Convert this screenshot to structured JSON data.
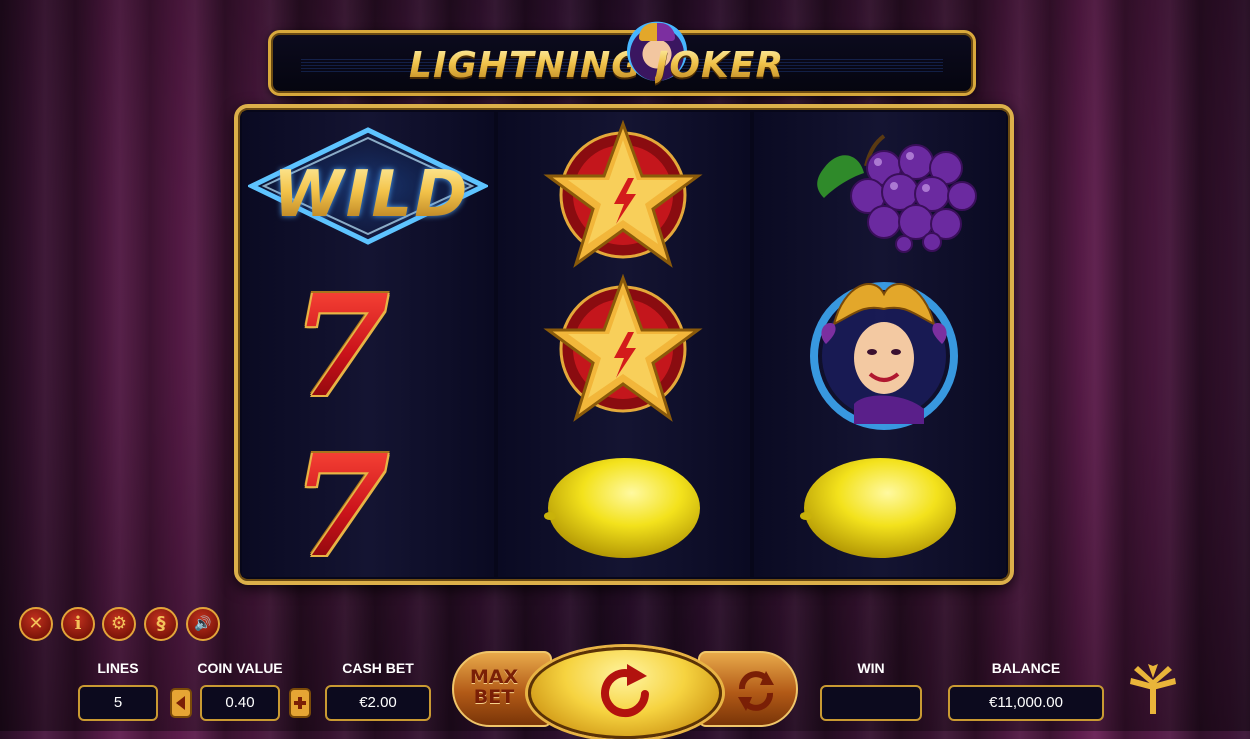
{
  "game": {
    "title_left": "LIGHTNING",
    "title_right": "JOKER"
  },
  "reels": [
    [
      "wild",
      "seven",
      "seven"
    ],
    [
      "star",
      "star",
      "lemon"
    ],
    [
      "grapes",
      "joker",
      "lemon"
    ]
  ],
  "symbols": {
    "wild_text": "WILD",
    "seven_text": "7"
  },
  "toolbar_icons": [
    {
      "name": "close-icon",
      "glyph": "✕"
    },
    {
      "name": "info-icon",
      "glyph": "i"
    },
    {
      "name": "settings-icon",
      "glyph": "⚙"
    },
    {
      "name": "paytable-icon",
      "glyph": "§"
    },
    {
      "name": "sound-icon",
      "glyph": "🔊"
    }
  ],
  "controls": {
    "lines_label": "LINES",
    "lines_value": "5",
    "coin_value_label": "COIN VALUE",
    "coin_value": "0.40",
    "cash_bet_label": "CASH BET",
    "cash_bet_value": "€2.00",
    "max_bet_label_1": "MAX",
    "max_bet_label_2": "BET",
    "win_label": "WIN",
    "win_value": "",
    "balance_label": "BALANCE",
    "balance_value": "€11,000.00"
  },
  "colors": {
    "gold": "#dcb04a",
    "reel_bg": "#07071a",
    "button_red": "#c2321f"
  }
}
